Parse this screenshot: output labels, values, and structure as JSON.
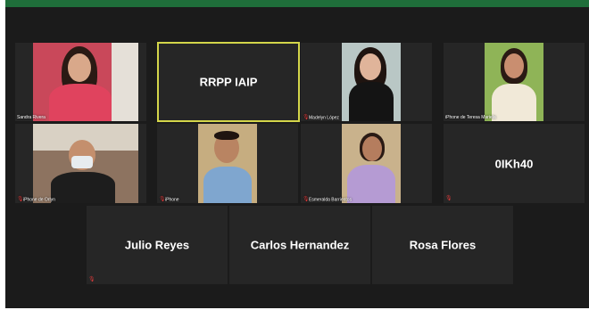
{
  "window": {
    "accent": "#1f6e3a",
    "active_speaker_outline": "#d4d64a",
    "muted_mic_color": "#e23b3b"
  },
  "participants": {
    "sandra": {
      "label": "Sandra Rivera"
    },
    "rrpp": {
      "display_name": "RRPP IAIP"
    },
    "madelyn": {
      "label": "Madelyn López"
    },
    "teresa": {
      "label": "iPhone de Teresa Mariela"
    },
    "orlyn": {
      "label": "iPhone de Orlyn"
    },
    "iphone": {
      "label": "iPhone"
    },
    "esmeralda": {
      "label": "Esmeralda Barrientos"
    },
    "oikh": {
      "display_name": "0IKh40"
    },
    "julio": {
      "display_name": "Julio Reyes"
    },
    "carlos": {
      "display_name": "Carlos Hernandez"
    },
    "rosa": {
      "display_name": "Rosa Flores"
    }
  }
}
